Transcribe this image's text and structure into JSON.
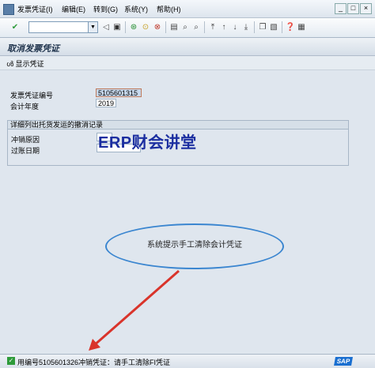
{
  "menu": {
    "items": [
      "发票凭证(I)",
      "编辑(E)",
      "转到(G)",
      "系统(Y)",
      "帮助(H)"
    ]
  },
  "window_controls": [
    "_",
    "□",
    "×"
  ],
  "toolbar": {
    "icons": [
      "check-icon",
      "back-icon",
      "save-icon",
      "back-nav-icon",
      "exit-icon",
      "cancel-icon",
      "print-icon",
      "find-icon",
      "find-next-icon",
      "first-page-icon",
      "prev-page-icon",
      "next-page-icon",
      "last-page-icon",
      "new-session-icon",
      "shortcut-icon",
      "help-icon",
      "layout-icon"
    ]
  },
  "page": {
    "title": "取消发票凭证",
    "display_button": "显示凭证"
  },
  "form": {
    "doc_number_label": "发票凭证编号",
    "doc_number_value": "5105601315",
    "fiscal_year_label": "会计年度",
    "fiscal_year_value": "2019"
  },
  "group": {
    "header": "详细列出托货发运的撤消记录",
    "reason_label": "冲销原因",
    "posting_date_label": "过账日期"
  },
  "watermark": "ERP财会讲堂",
  "annotation": "系统提示手工清除会计凭证",
  "status": {
    "message": "用编号5105601326冲销凭证：请手工清除FI凭证",
    "sap_logo": "SAP"
  },
  "colors": {
    "accent": "#1b2ea0",
    "annotation_border": "#3b86d0",
    "arrow": "#d9342b",
    "success": "#2e9b3a"
  }
}
